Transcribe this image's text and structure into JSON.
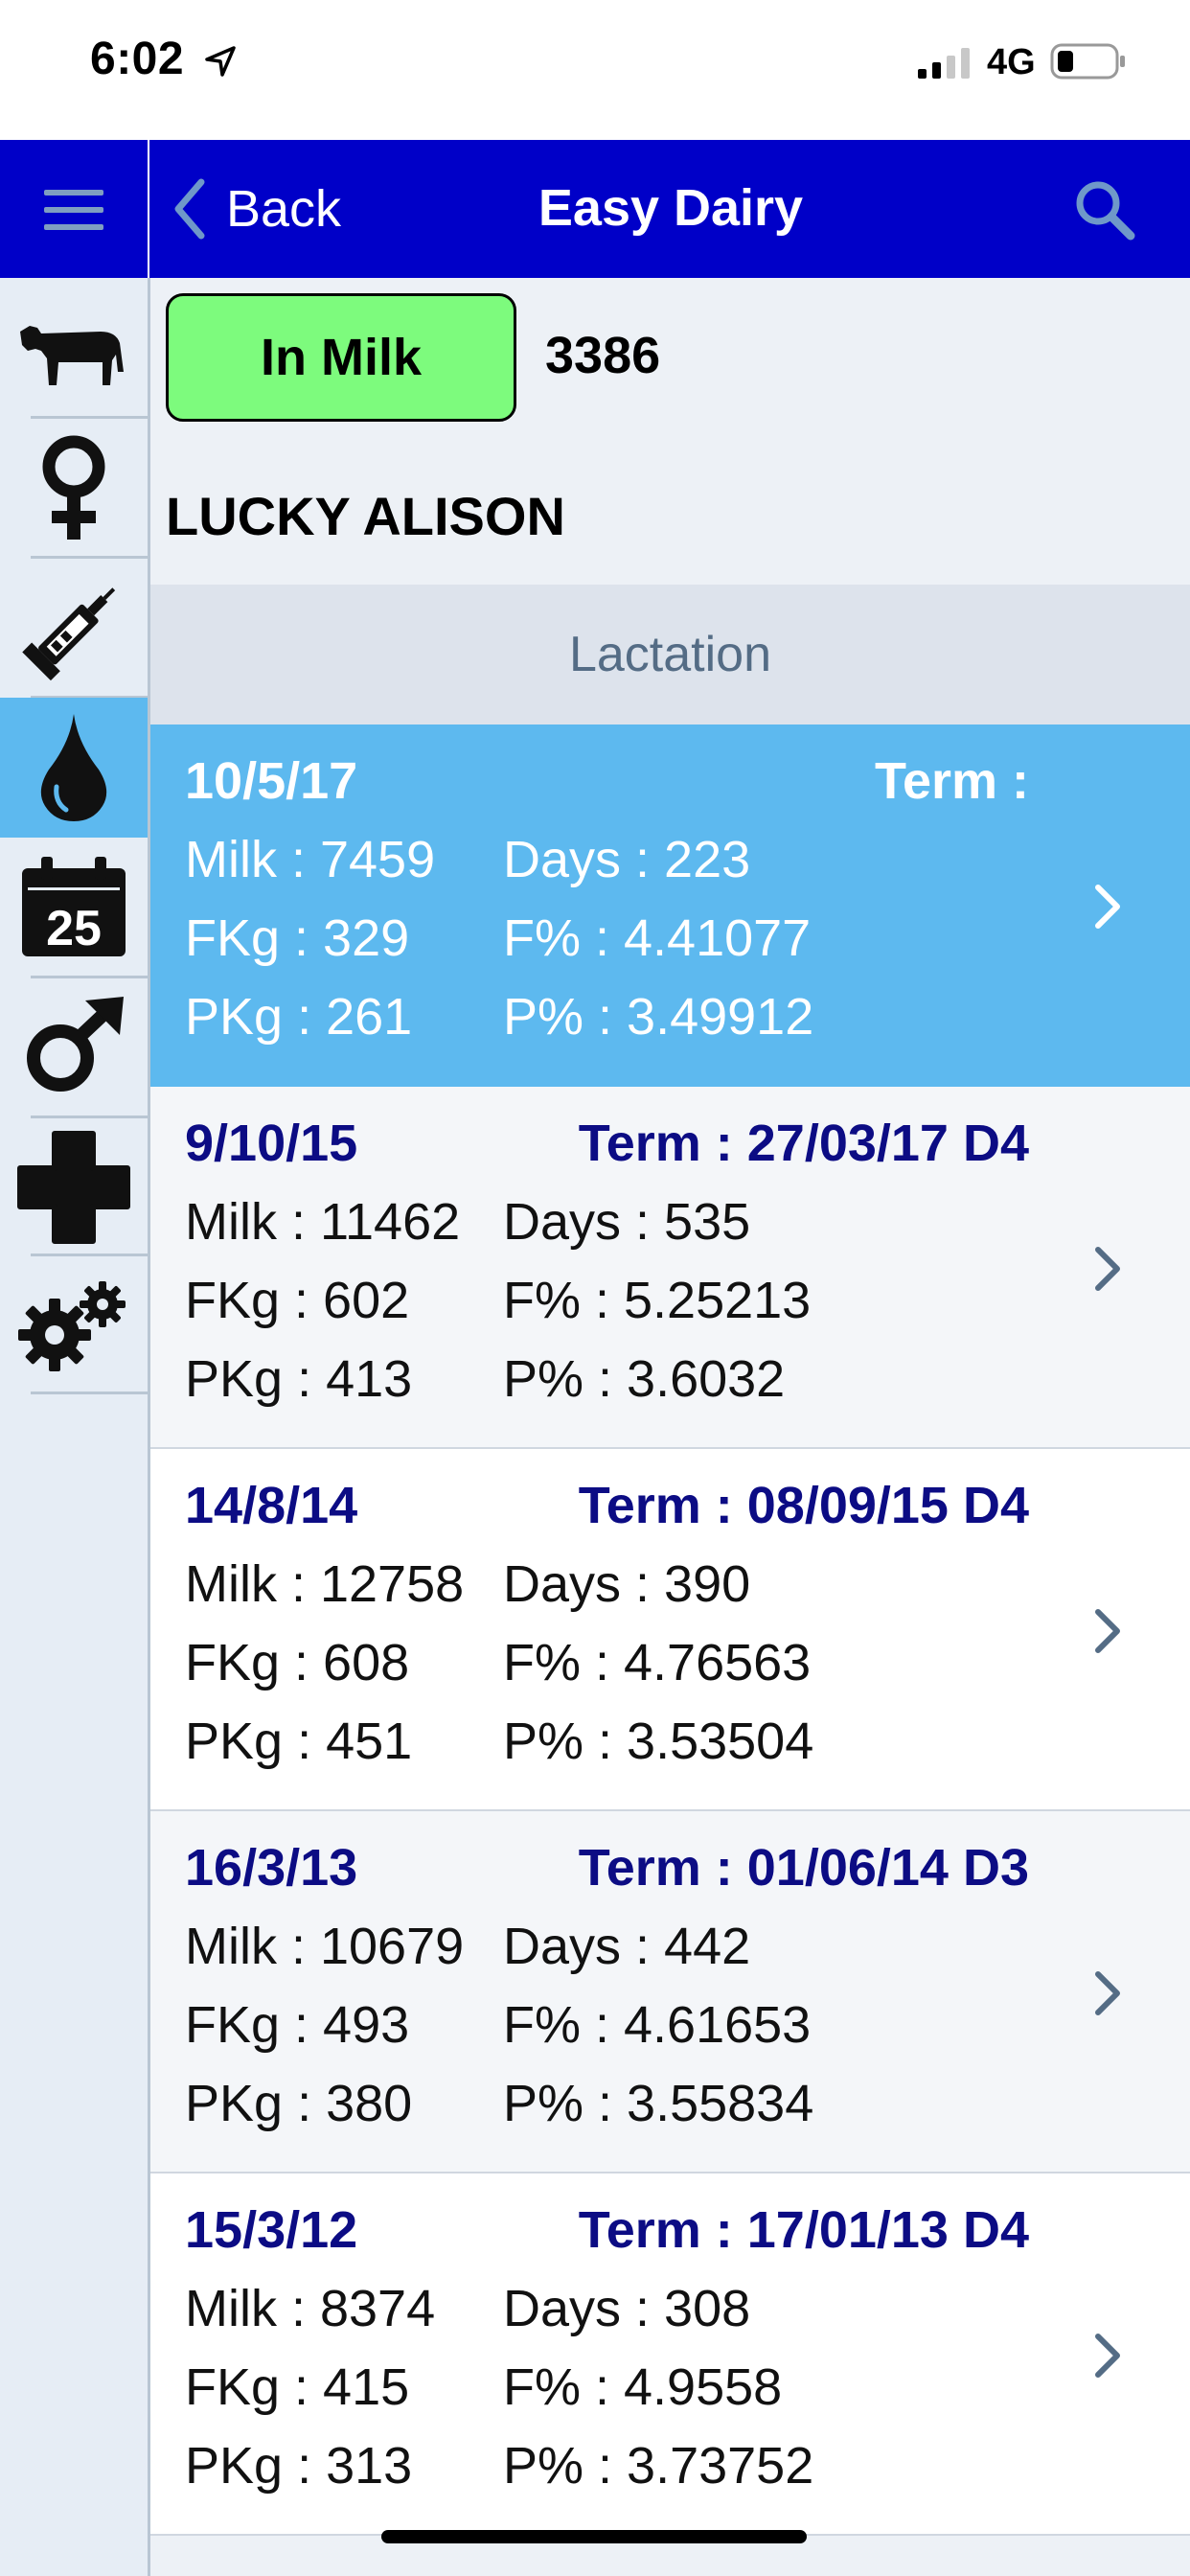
{
  "status_bar": {
    "time": "6:02",
    "network": "4G"
  },
  "nav": {
    "back_label": "Back",
    "title": "Easy Dairy"
  },
  "sidebar": {
    "items": [
      {
        "name": "cow"
      },
      {
        "name": "female"
      },
      {
        "name": "syringe"
      },
      {
        "name": "milk-drop",
        "active": true
      },
      {
        "name": "calendar",
        "label": "25"
      },
      {
        "name": "male"
      },
      {
        "name": "health-cross"
      },
      {
        "name": "settings"
      }
    ]
  },
  "animal": {
    "status": "In Milk",
    "number": "3386",
    "name": "LUCKY ALISON"
  },
  "section": {
    "title": "Lactation"
  },
  "lactations": [
    {
      "date": "10/5/17",
      "term": "Term :",
      "milk": "Milk : 7459",
      "days": "Days : 223",
      "fkg": "FKg : 329",
      "fpct": "F% : 4.41077",
      "pkg": "PKg : 261",
      "ppct": "P% : 3.49912",
      "selected": true
    },
    {
      "date": "9/10/15",
      "term": "Term : 27/03/17 D4",
      "milk": "Milk : 11462",
      "days": "Days : 535",
      "fkg": "FKg : 602",
      "fpct": "F% : 5.25213",
      "pkg": "PKg : 413",
      "ppct": "P% : 3.6032"
    },
    {
      "date": "14/8/14",
      "term": "Term : 08/09/15 D4",
      "milk": "Milk : 12758",
      "days": "Days : 390",
      "fkg": "FKg : 608",
      "fpct": "F% : 4.76563",
      "pkg": "PKg : 451",
      "ppct": "P% : 3.53504"
    },
    {
      "date": "16/3/13",
      "term": "Term : 01/06/14 D3",
      "milk": "Milk : 10679",
      "days": "Days : 442",
      "fkg": "FKg : 493",
      "fpct": "F% : 4.61653",
      "pkg": "PKg : 380",
      "ppct": "P% : 3.55834"
    },
    {
      "date": "15/3/12",
      "term": "Term : 17/01/13 D4",
      "milk": "Milk : 8374",
      "days": "Days : 308",
      "fkg": "FKg : 415",
      "fpct": "F% : 4.9558",
      "pkg": "PKg : 313",
      "ppct": "P% : 3.73752"
    }
  ],
  "colors": {
    "nav": "#0000c8",
    "selected_row": "#5db9ef",
    "badge": "#7dfb7d",
    "date_text": "#0c0c84"
  }
}
